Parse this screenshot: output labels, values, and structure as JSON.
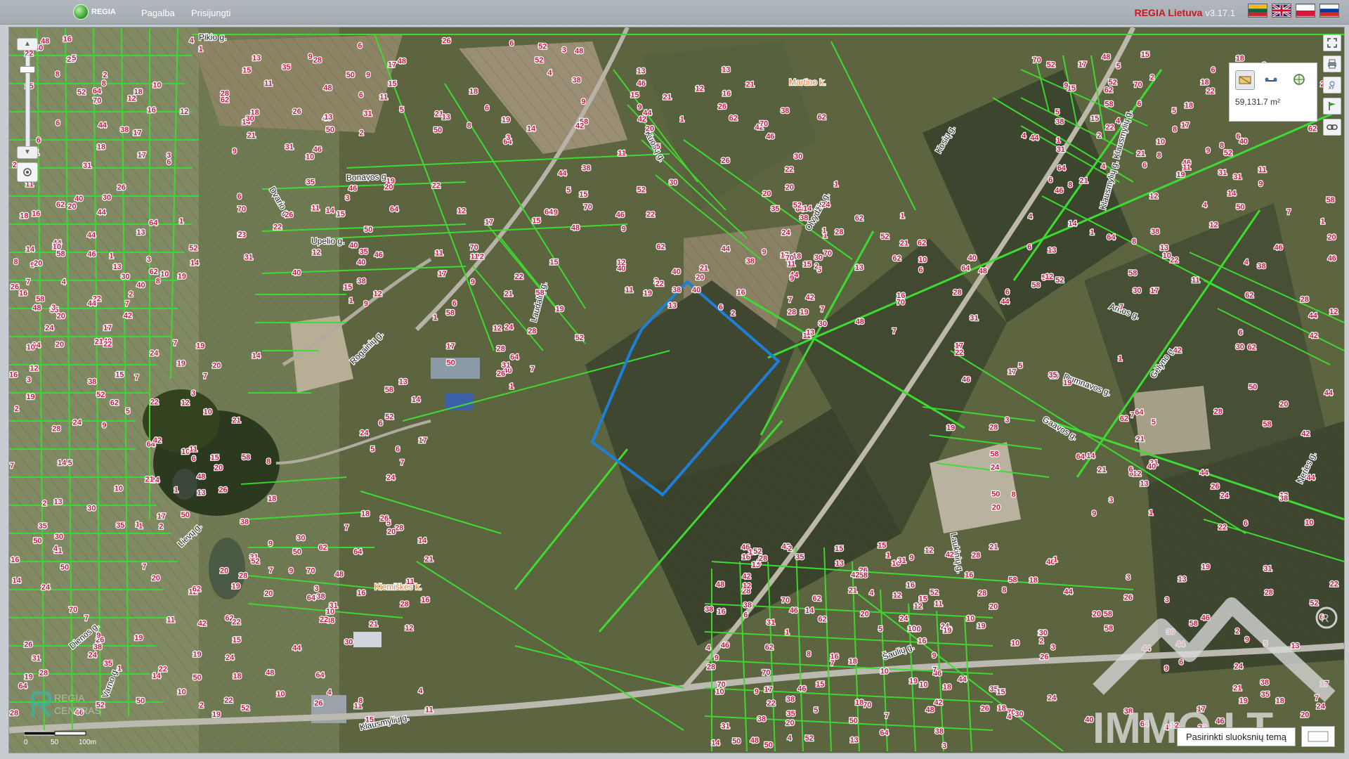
{
  "header": {
    "logo_text": "REGIA",
    "nav": [
      {
        "label": "Pagalba"
      },
      {
        "label": "Prisijungti"
      }
    ],
    "brand": "REGIA Lietuva",
    "version": "v3.17.1",
    "languages": [
      {
        "code": "lt",
        "colors": [
          "#fdb913",
          "#006a44",
          "#c1272d"
        ]
      },
      {
        "code": "en",
        "colors": [
          "#012169",
          "#ffffff",
          "#c8102e"
        ]
      },
      {
        "code": "pl",
        "colors": [
          "#ffffff",
          "#dc143c"
        ]
      },
      {
        "code": "ru",
        "colors": [
          "#ffffff",
          "#0039a6",
          "#d52b1e"
        ]
      }
    ]
  },
  "map": {
    "parcel_color": "#38d12c",
    "selection_color": "#1e7fd8",
    "label_color": "#c41c44",
    "streets": [
      {
        "name": "Pikio g."
      },
      {
        "name": "Bonavos g."
      },
      {
        "name": "Upelio g."
      },
      {
        "name": "Kuosų g."
      },
      {
        "name": "Kosių g."
      },
      {
        "name": "Olvydžio g."
      },
      {
        "name": "Rogainių g."
      },
      {
        "name": "Laudalių g."
      },
      {
        "name": "Klausmylių g."
      },
      {
        "name": "Klausmylių g. Klausmylių g."
      },
      {
        "name": "Arnos g."
      },
      {
        "name": "Dumnavos g."
      },
      {
        "name": "Gaavos g."
      },
      {
        "name": "Lievų g."
      },
      {
        "name": "Dienos g."
      },
      {
        "name": "Šaulių g."
      },
      {
        "name": "Neries g."
      },
      {
        "name": "Varno g."
      },
      {
        "name": "Martino k."
      },
      {
        "name": "Klemiškės k."
      },
      {
        "name": "Dvario g."
      },
      {
        "name": "Laukinių g."
      },
      {
        "name": "Gėlyno g."
      }
    ],
    "parcel_numbers": [
      "1",
      "3",
      "5",
      "7",
      "9",
      "11",
      "13",
      "15",
      "17",
      "19",
      "21",
      "2",
      "4",
      "6",
      "8",
      "10",
      "12",
      "14",
      "16",
      "18",
      "20",
      "22",
      "24",
      "26",
      "28",
      "30",
      "31",
      "35",
      "38",
      "40",
      "42",
      "44",
      "46",
      "48",
      "50",
      "52",
      "58",
      "62",
      "64",
      "70"
    ],
    "scale_labels": [
      "0",
      "50",
      "100m"
    ],
    "watermarks": {
      "immo": "IMMO.LT",
      "centras": "REGIA CENTRAS"
    }
  },
  "controls": {
    "zoom_in": "▲",
    "zoom_out": "▼",
    "measure": {
      "tools": [
        "area-measure-icon",
        "distance-measure-icon",
        "location-measure-icon"
      ],
      "area_value": "59,131.7 m²"
    },
    "side_tools": [
      "fullscreen-icon",
      "print-icon",
      "xy-coordinates-icon",
      "flag-icon",
      "link-icon"
    ],
    "layer_theme_button": "Pasirinkti sluoksnių temą"
  }
}
